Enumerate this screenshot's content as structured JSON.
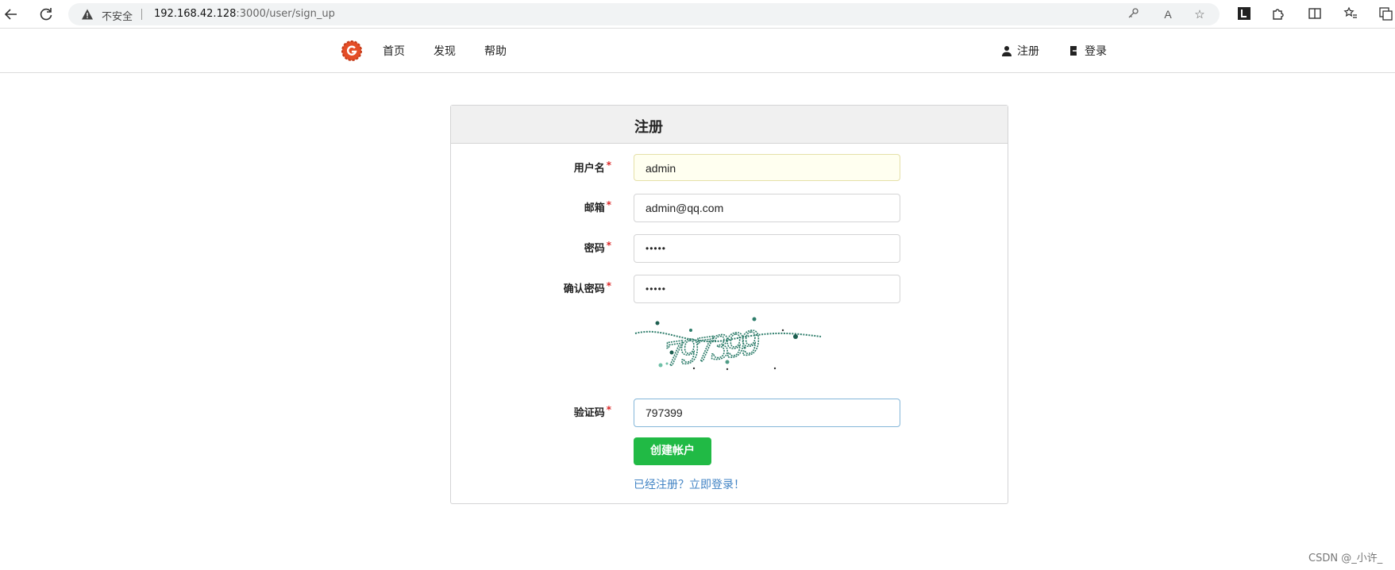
{
  "browser": {
    "security_label": "不安全",
    "url_host": "192.168.42.128",
    "url_path": ":3000/user/sign_up"
  },
  "nav": {
    "links": [
      "首页",
      "发现",
      "帮助"
    ],
    "register": "注册",
    "login": "登录"
  },
  "form": {
    "title": "注册",
    "required_mark": "*",
    "fields": [
      {
        "label": "用户名",
        "value": "admin"
      },
      {
        "label": "邮箱",
        "value": "admin@qq.com"
      },
      {
        "label": "密码",
        "value": "•••••"
      },
      {
        "label": "确认密码",
        "value": "•••••"
      },
      {
        "label": "验证码",
        "value": "797399"
      }
    ],
    "captcha_text": "797399",
    "submit_label": "创建帐户",
    "signin_link": "已经注册？立即登录！"
  },
  "watermark": "CSDN @_小许_",
  "colors": {
    "brand": "#e44d26",
    "submit": "#21ba45",
    "link": "#4183c4",
    "required": "#db2828"
  }
}
